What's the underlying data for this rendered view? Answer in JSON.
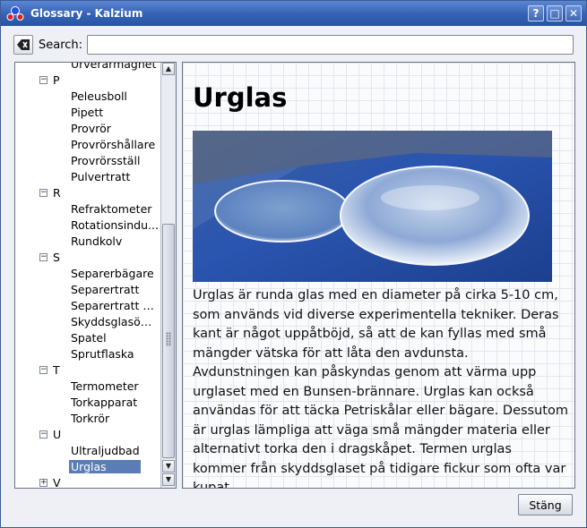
{
  "window": {
    "title": "Glossary - Kalzium"
  },
  "titlebar_buttons": {
    "help": "?",
    "maximize": "□",
    "close": "✕"
  },
  "search": {
    "label": "Search:",
    "value": "",
    "placeholder": ""
  },
  "tree": {
    "partial_top": "Urverarmagnet",
    "groups": [
      {
        "letter": "P",
        "expander": "−",
        "items": [
          "Peleusboll",
          "Pipett",
          "Provrör",
          "Provrörshållare",
          "Provrörsställ",
          "Pulvertratt"
        ]
      },
      {
        "letter": "R",
        "expander": "−",
        "items": [
          "Refraktometer",
          "Rotationsindu...",
          "Rundkolv"
        ]
      },
      {
        "letter": "S",
        "expander": "−",
        "items": [
          "Separerbägare",
          "Separertratt",
          "Separertratt m...",
          "Skyddsglasögon",
          "Spatel",
          "Sprutflaska"
        ]
      },
      {
        "letter": "T",
        "expander": "−",
        "items": [
          "Termometer",
          "Torkapparat",
          "Torkrör"
        ]
      },
      {
        "letter": "U",
        "expander": "−",
        "items": [
          "Ultraljudbad",
          "Urglas"
        ]
      },
      {
        "letter": "V",
        "expander": "+",
        "items": []
      }
    ],
    "selected": "Urglas"
  },
  "article": {
    "title": "Urglas",
    "body": "Urglas är runda glas med en diameter på cirka 5-10 cm, som används vid diverse experimentella tekniker. Deras kant är något uppåtböjd, så att de kan fyllas med små mängder vätska för att låta den avdunsta. Avdunstningen kan påskyndas genom att värma upp urglaset med en Bunsen-brännare. Urglas kan också användas för att täcka Petriskålar eller bägare. Dessutom är urglas lämpliga att väga små mängder materia eller alternativt torka den i dragskåpet. Termen urglas kommer från skyddsglaset på tidigare fickur som ofta var kupat."
  },
  "footer": {
    "close_label": "Stäng"
  },
  "colors": {
    "titlebar": "#3361b3",
    "selection": "#5a7db5",
    "window_bg": "#eef0f5"
  }
}
